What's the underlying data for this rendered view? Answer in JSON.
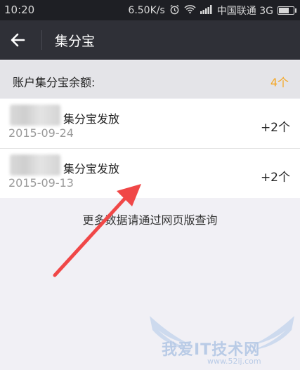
{
  "status_bar": {
    "time": "10:20",
    "speed": "6.50K/s",
    "carrier": "中国联通 3G"
  },
  "app_bar": {
    "title": "集分宝"
  },
  "balance": {
    "label": "账户集分宝余额:",
    "value": "4个"
  },
  "records": [
    {
      "desc": "集分宝发放",
      "date": "2015-09-24",
      "amount": "+2个"
    },
    {
      "desc": "集分宝发放",
      "date": "2015-09-13",
      "amount": "+2个"
    }
  ],
  "hint": "更多数据请通过网页版查询",
  "watermark": {
    "text": "我爱IT技术网",
    "url": "www.52ij.com"
  },
  "colors": {
    "status_bar": "#1e1f24",
    "app_bar": "#2f3037",
    "accent": "#f5a623",
    "arrow": "#f04747"
  }
}
